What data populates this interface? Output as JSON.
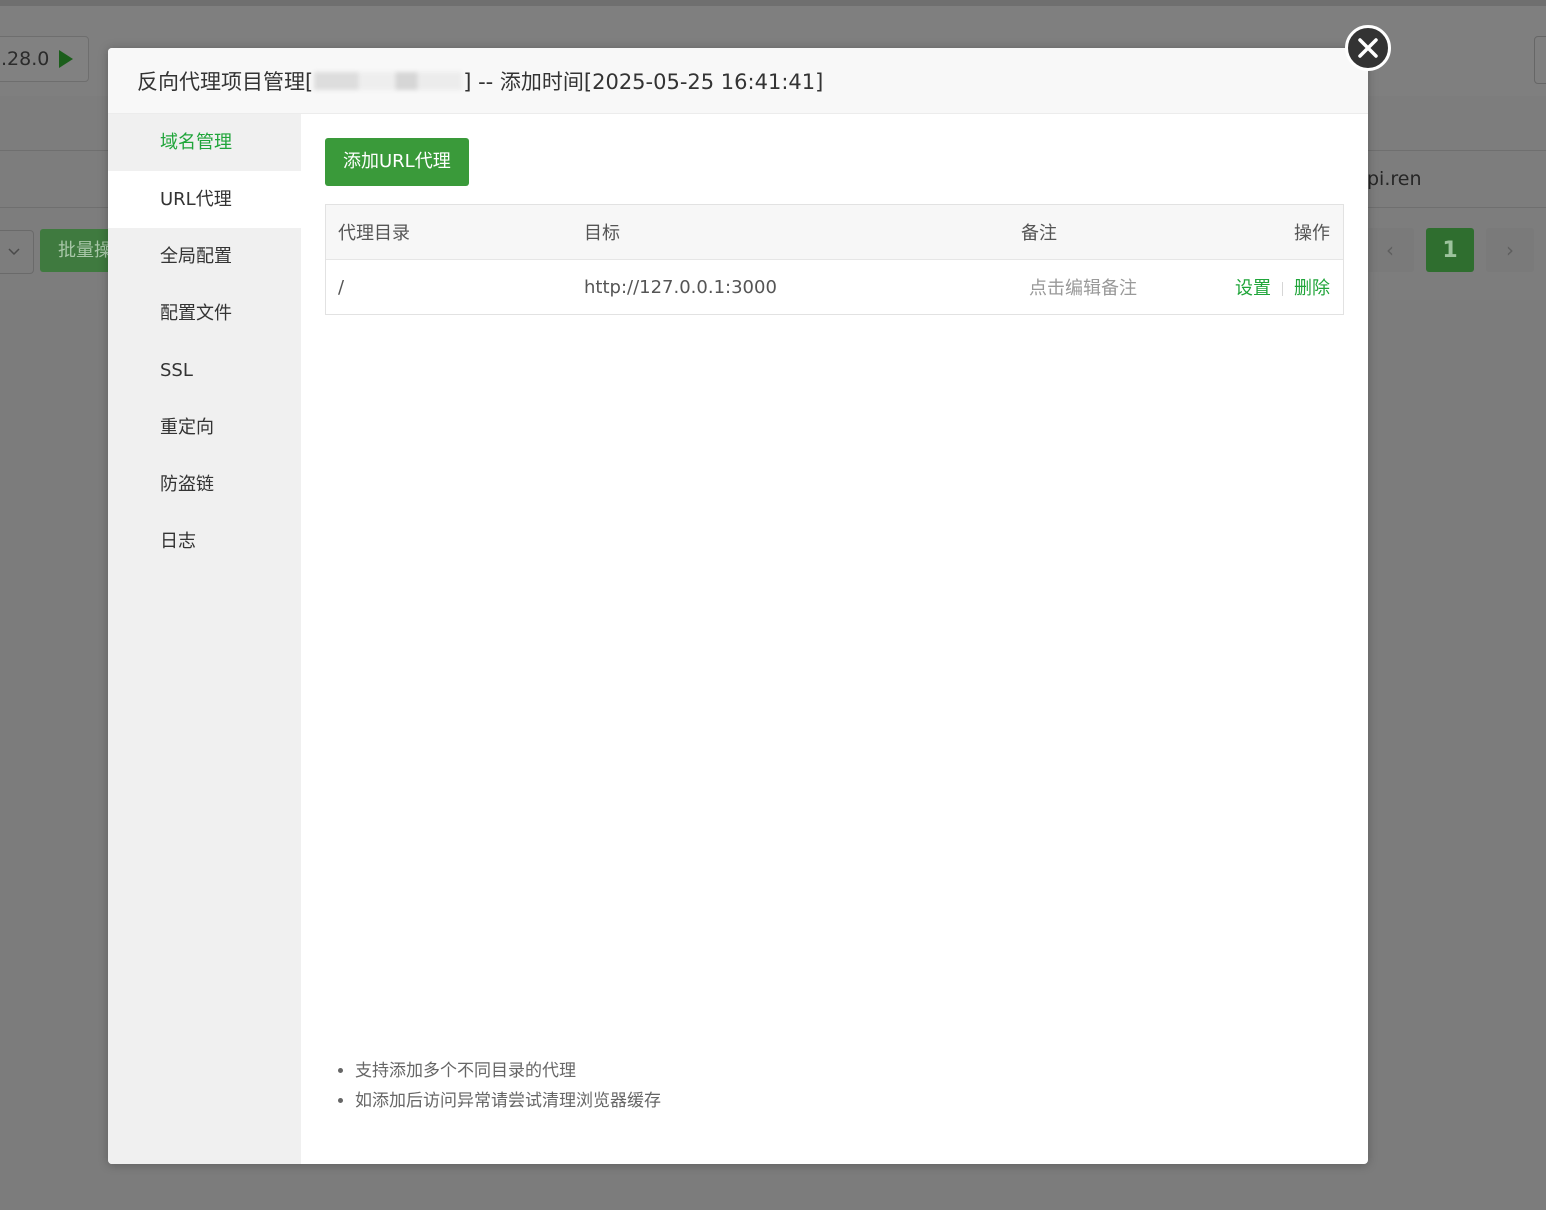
{
  "background": {
    "version_text": ".28.0",
    "domain_fragment": "pi.ren",
    "batch_button_label": "批量操",
    "pagination": {
      "prev": "‹",
      "current": "1",
      "next": "›"
    }
  },
  "modal": {
    "title_prefix": "反向代理项目管理[",
    "title_suffix": "] -- 添加时间[2025-05-25 16:41:41]",
    "sidebar": [
      {
        "label": "域名管理"
      },
      {
        "label": "URL代理"
      },
      {
        "label": "全局配置"
      },
      {
        "label": "配置文件"
      },
      {
        "label": "SSL"
      },
      {
        "label": "重定向"
      },
      {
        "label": "防盗链"
      },
      {
        "label": "日志"
      }
    ],
    "add_button_label": "添加URL代理",
    "table": {
      "headers": [
        "代理目录",
        "目标",
        "备注",
        "操作"
      ],
      "rows": [
        {
          "path": "/",
          "target": "http://127.0.0.1:3000",
          "remark": "点击编辑备注",
          "actions": [
            "设置",
            "删除"
          ]
        }
      ]
    },
    "tips": [
      "支持添加多个不同目录的代理",
      "如添加后访问异常请尝试清理浏览器缓存"
    ]
  },
  "colors": {
    "accent": "#20a53a",
    "button": "#3a9a3a"
  },
  "icons": {
    "close": "close-icon",
    "play": "play-icon"
  }
}
